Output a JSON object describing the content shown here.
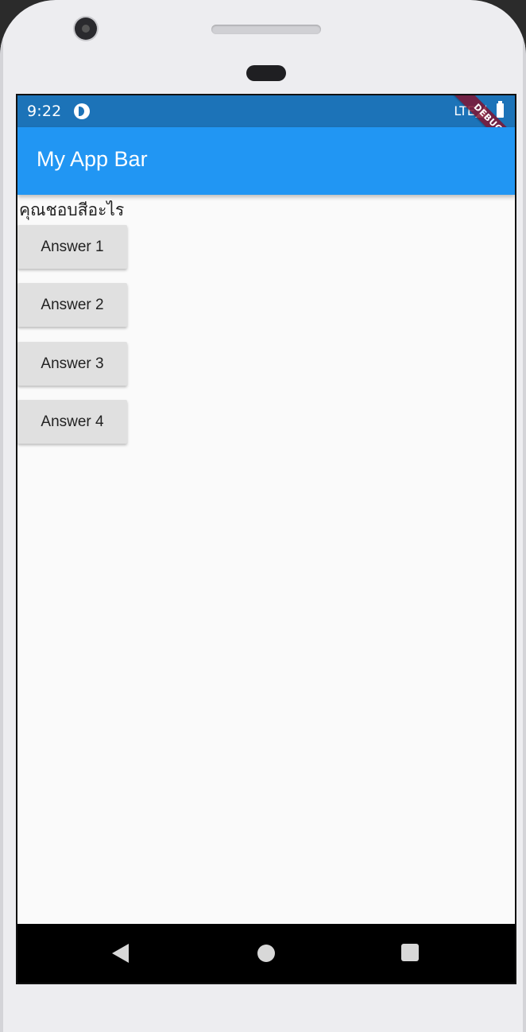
{
  "status_bar": {
    "time": "9:22",
    "network": "LTE",
    "debug_label": "DEBUG",
    "background_color": "#1c73b8"
  },
  "app_bar": {
    "title": "My App Bar",
    "background_color": "#2196f3"
  },
  "body": {
    "question": "คุณชอบสีอะไร",
    "answers": [
      "Answer 1",
      "Answer 2",
      "Answer 3",
      "Answer 4"
    ]
  },
  "nav_bar": {
    "icons": [
      "back-icon",
      "home-icon",
      "recents-icon"
    ]
  }
}
